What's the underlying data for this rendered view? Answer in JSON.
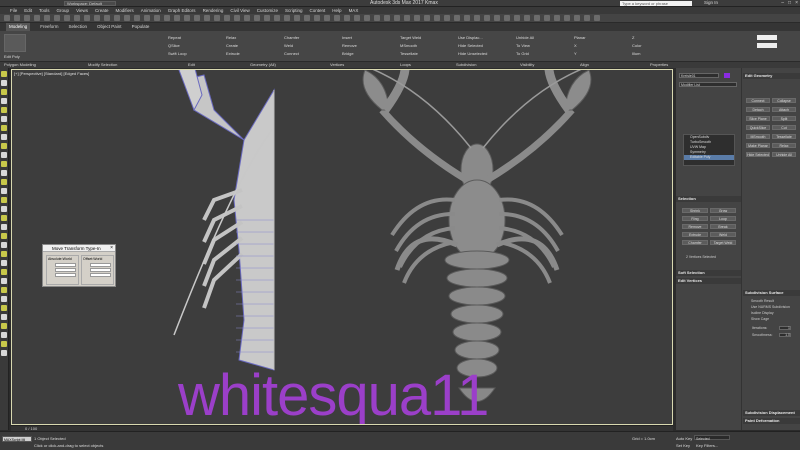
{
  "titlebar": {
    "workspace": "Workspace: Default",
    "title": "Autodesk 3ds Max 2017    Kmax",
    "search_placeholder": "Type a keyword or phrase",
    "signin": "Sign In"
  },
  "menus": [
    "File",
    "Edit",
    "Tools",
    "Group",
    "Views",
    "Create",
    "Modifiers",
    "Animation",
    "Graph Editors",
    "Rendering",
    "Civil View",
    "Customize",
    "Scripting",
    "Content",
    "Help",
    "MAX"
  ],
  "tabs": [
    "Modeling",
    "Freeform",
    "Selection",
    "Object Paint",
    "Populate"
  ],
  "ribbon": {
    "edit_poly": "Edit Poly",
    "items": [
      "Repeat",
      "QSlice",
      "Swift Loop",
      "Relax",
      "Create",
      "Extrude",
      "Chamfer",
      "Weld",
      "Connect",
      "Insert",
      "Remove",
      "Bridge",
      "Target Weld",
      "MSmooth",
      "Tessellate",
      "Use Displac...",
      "Hide Selected",
      "Hide Unselected",
      "Unhide All",
      "To View",
      "To Grid",
      "Planar",
      "X",
      "Y",
      "Z",
      "Color",
      "Illum"
    ],
    "sections": [
      "Polygon Modeling",
      "Modify Selection",
      "Edit",
      "Geometry (All)",
      "Vertices",
      "Loops",
      "Subdivision",
      "Visibility",
      "Align",
      "Properties"
    ]
  },
  "viewport": {
    "label": "[+] [Perspective] [Standard] [Edged Faces]"
  },
  "watermark": "whitesqua11",
  "dialog": {
    "title": "Move Transform Type-In",
    "left_caption": "Absolute:World",
    "right_caption": "Offset:World",
    "axes": [
      "X:",
      "Y:",
      "Z:"
    ]
  },
  "command_panel": {
    "object_name": "Kreisle01",
    "modifier_list": "Modifier List",
    "stack": [
      "OpenSubdiv",
      "TurboSmooth",
      "UVW Map",
      "Symmetry",
      "Editable Poly"
    ],
    "selected_stack_index": 4,
    "rollouts": [
      "Selection",
      "Soft Selection",
      "Edit Vertices",
      "Edit Geometry",
      "Subdivision Surface",
      "Subdivision Displacement",
      "Paint Deformation"
    ],
    "status_line": "2 Vertices Selected",
    "buttons": [
      "Shrink",
      "Grow",
      "Ring",
      "Loop",
      "Remove",
      "Break",
      "Extrude",
      "Weld",
      "Chamfer",
      "Target Weld",
      "Connect",
      "Collapse",
      "Detach",
      "Attach",
      "Slice Plane",
      "Split",
      "QuickSlice",
      "Cut",
      "MSmooth",
      "Tessellate",
      "Make Planar",
      "Relax",
      "Hide Selected",
      "Unhide All"
    ],
    "checkboxes": [
      "Smooth Result",
      "Use NURMS Subdivision",
      "Isoline Display",
      "Show Cage"
    ],
    "iterations_label": "Iterations:",
    "iterations": "1",
    "smoothness_label": "Smoothness:",
    "smoothness": "1.0"
  },
  "status": {
    "selected": "1 Object Selected",
    "prompt": "Click or click-and-drag to select objects",
    "frame": "0 / 100",
    "grid": "Grid = 1.0cm",
    "autokey": "Auto Key",
    "setkey": "Set Key",
    "selected_dd": "Selected",
    "keyfilters": "Key Filters...",
    "maxscript": "MAXScript Mi"
  },
  "colors": {
    "accent": "#5a7ca8",
    "watermark": "#9b3fc9",
    "viewport_bg": "#3d3d3d"
  }
}
